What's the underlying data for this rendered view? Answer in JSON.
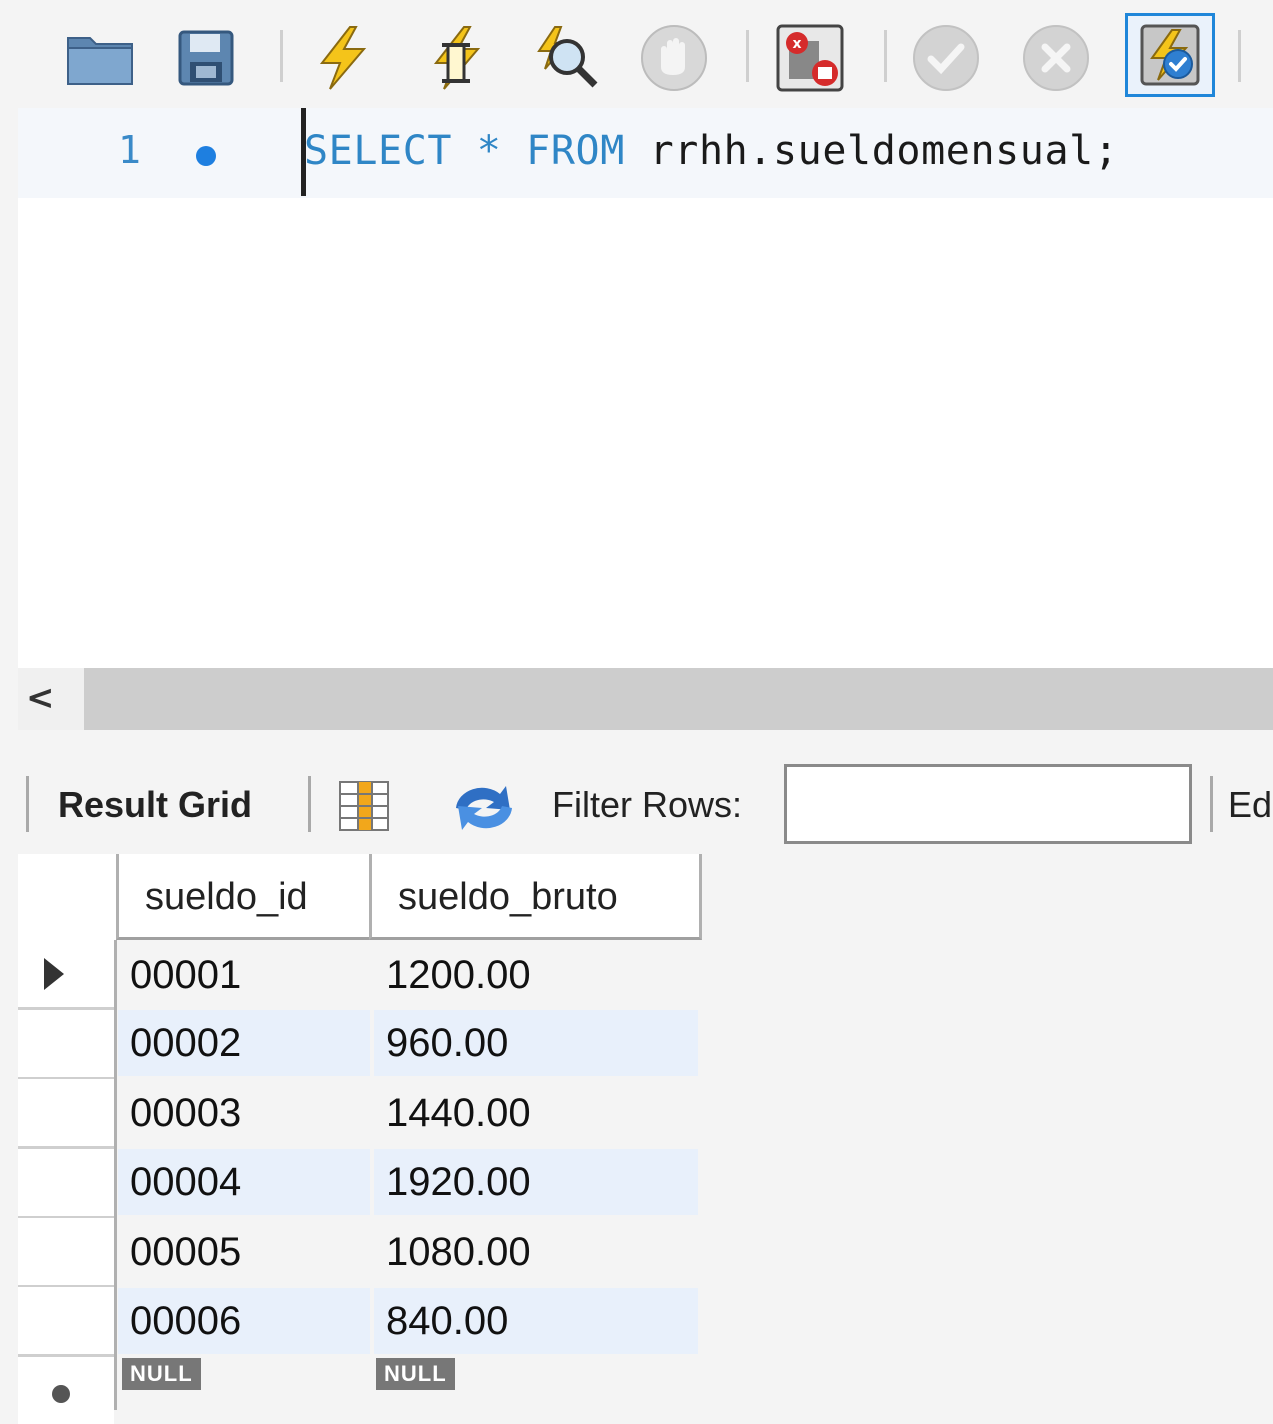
{
  "toolbar": {
    "buttons": [
      {
        "name": "open-folder-icon"
      },
      {
        "name": "save-icon"
      },
      {
        "name": "execute-icon"
      },
      {
        "name": "execute-current-statement-icon"
      },
      {
        "name": "explain-icon"
      },
      {
        "name": "stop-icon"
      },
      {
        "name": "stop-on-error-icon"
      },
      {
        "name": "commit-icon"
      },
      {
        "name": "rollback-icon"
      },
      {
        "name": "autocommit-toggle-icon"
      }
    ]
  },
  "editor": {
    "line_number": "1",
    "code": {
      "kw1": "SELECT",
      "star": "*",
      "kw2": "FROM",
      "ident": "rrhh.sueldomensual;"
    }
  },
  "scrollbar": {
    "left_arrow": "<"
  },
  "result_toolbar": {
    "result_grid_label": "Result Grid",
    "filter_rows_label": "Filter Rows:",
    "filter_value": "",
    "edit_label_partial": "Ed"
  },
  "grid": {
    "columns": [
      "sueldo_id",
      "sueldo_bruto"
    ],
    "rows": [
      [
        "00001",
        "1200.00"
      ],
      [
        "00002",
        "960.00"
      ],
      [
        "00003",
        "1440.00"
      ],
      [
        "00004",
        "1920.00"
      ],
      [
        "00005",
        "1080.00"
      ],
      [
        "00006",
        "840.00"
      ]
    ],
    "null_label": "NULL"
  },
  "colors": {
    "keyword": "#2f86c6",
    "selection_border": "#1f86d9",
    "alt_row": "#e8f0fb"
  }
}
